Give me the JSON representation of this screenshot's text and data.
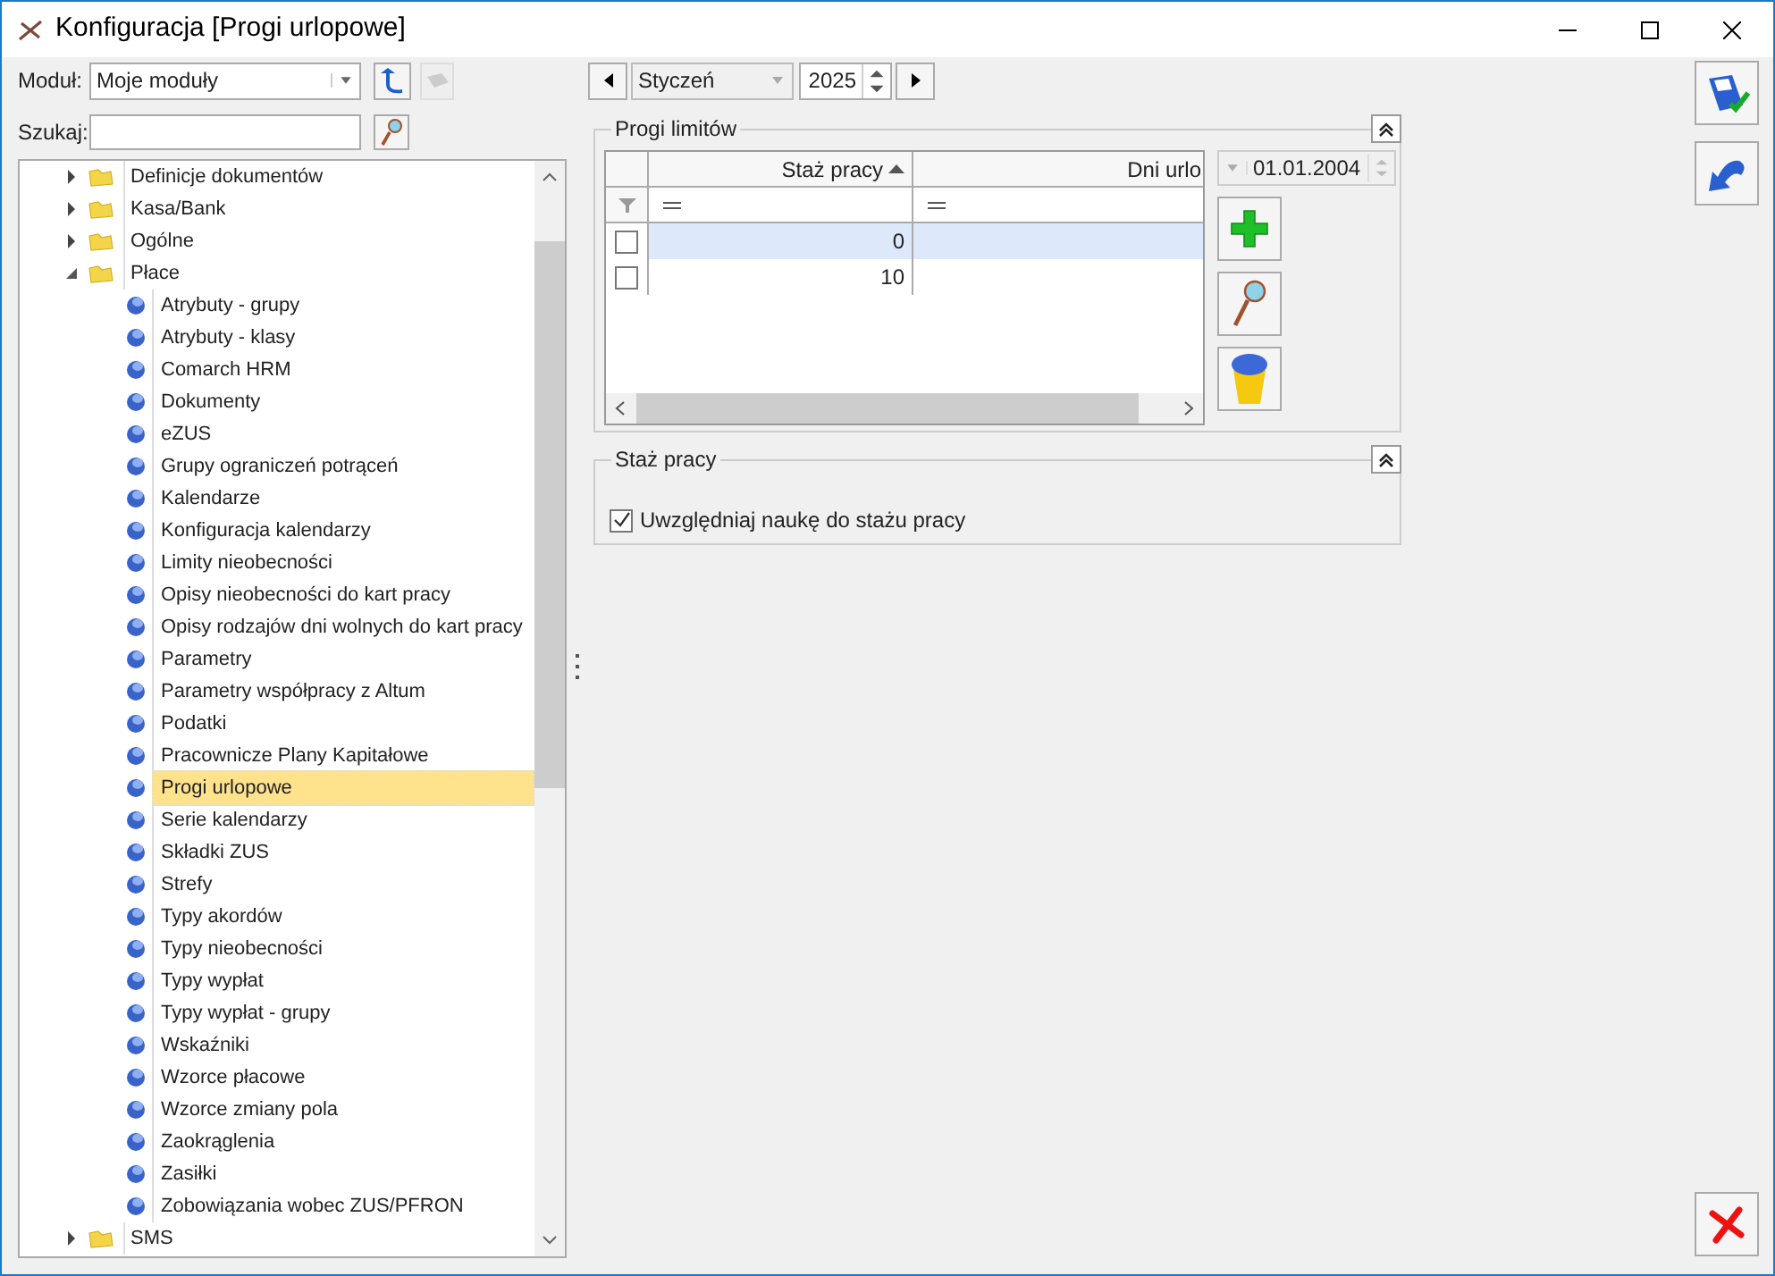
{
  "window": {
    "title": "Konfiguracja [Progi urlopowe]"
  },
  "module": {
    "label": "Moduł:",
    "value": "Moje moduły"
  },
  "search": {
    "label": "Szukaj:"
  },
  "tree": [
    {
      "label": "Definicje dokumentów",
      "expanded": false
    },
    {
      "label": "Kasa/Bank",
      "expanded": false
    },
    {
      "label": "Ogólne",
      "expanded": false
    },
    {
      "label": "Płace",
      "expanded": true,
      "children": [
        {
          "label": "Atrybuty - grupy",
          "selected": false
        },
        {
          "label": "Atrybuty - klasy",
          "selected": false
        },
        {
          "label": "Comarch HRM",
          "selected": false
        },
        {
          "label": "Dokumenty",
          "selected": false
        },
        {
          "label": "eZUS",
          "selected": false
        },
        {
          "label": "Grupy ograniczeń potrąceń",
          "selected": false
        },
        {
          "label": "Kalendarze",
          "selected": false
        },
        {
          "label": "Konfiguracja kalendarzy",
          "selected": false
        },
        {
          "label": "Limity nieobecności",
          "selected": false
        },
        {
          "label": "Opisy nieobecności do kart pracy",
          "selected": false
        },
        {
          "label": "Opisy rodzajów dni wolnych do kart pracy",
          "selected": false
        },
        {
          "label": "Parametry",
          "selected": false
        },
        {
          "label": "Parametry współpracy z Altum",
          "selected": false
        },
        {
          "label": "Podatki",
          "selected": false
        },
        {
          "label": "Pracownicze Plany Kapitałowe",
          "selected": false
        },
        {
          "label": "Progi urlopowe",
          "selected": true
        },
        {
          "label": "Serie kalendarzy",
          "selected": false
        },
        {
          "label": "Składki ZUS",
          "selected": false
        },
        {
          "label": "Strefy",
          "selected": false
        },
        {
          "label": "Typy akordów",
          "selected": false
        },
        {
          "label": "Typy nieobecności",
          "selected": false
        },
        {
          "label": "Typy wypłat",
          "selected": false
        },
        {
          "label": "Typy wypłat - grupy",
          "selected": false
        },
        {
          "label": "Wskaźniki",
          "selected": false
        },
        {
          "label": "Wzorce płacowe",
          "selected": false
        },
        {
          "label": "Wzorce zmiany pola",
          "selected": false
        },
        {
          "label": "Zaokrąglenia",
          "selected": false
        },
        {
          "label": "Zasiłki",
          "selected": false
        },
        {
          "label": "Zobowiązania wobec ZUS/PFRON",
          "selected": false
        }
      ]
    },
    {
      "label": "SMS",
      "expanded": false
    }
  ],
  "period": {
    "month": "Styczeń",
    "year": "2025"
  },
  "limits_group": {
    "title": "Progi limitów",
    "columns": [
      "Staż pracy",
      "Dni urlo"
    ],
    "date": "01.01.2004",
    "rows": [
      {
        "checked": false,
        "selected": true,
        "cells": [
          "0",
          ""
        ]
      },
      {
        "checked": false,
        "selected": false,
        "cells": [
          "10",
          ""
        ]
      }
    ]
  },
  "seniority_group": {
    "title": "Staż pracy",
    "option": {
      "label": "Uwzględniaj naukę do stażu pracy",
      "checked": true
    }
  }
}
